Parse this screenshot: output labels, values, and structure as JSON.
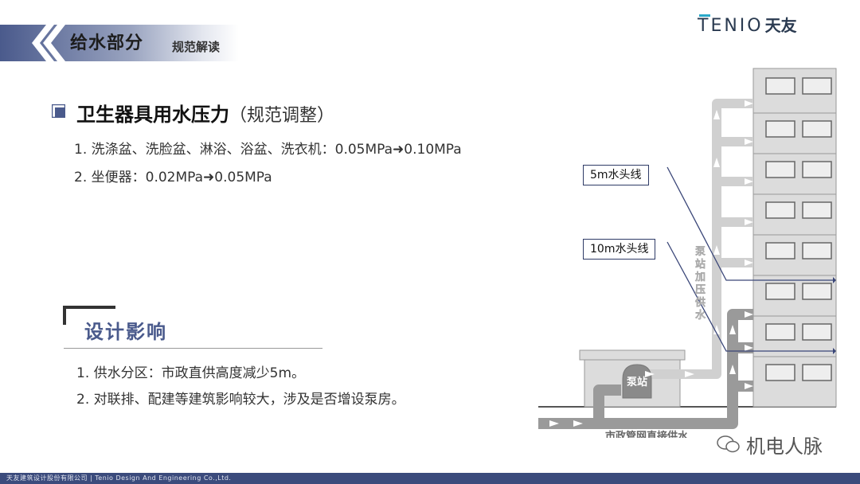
{
  "header": {
    "title": "给水部分",
    "subtitle": "规范解读"
  },
  "logo": {
    "en": "TENIO",
    "cn": "天友"
  },
  "section": {
    "heading": "卫生器具用水压力",
    "heading_note": "（规范调整）",
    "line1": "1. 洗涤盆、洗脸盆、淋浴、浴盆、洗衣机：0.05MPa➜0.10MPa",
    "line2": "2. 坐便器：0.02MPa➜0.05MPa"
  },
  "impact": {
    "title": "设计影响",
    "items": [
      "1.  供水分区：市政直供高度减少5m。",
      "2.  对联排、配建等建筑影响较大，涉及是否增设泵房。"
    ]
  },
  "diagram": {
    "label_5m": "5m水头线",
    "label_10m": "10m水头线",
    "pump_station": "泵站",
    "pump_supply_vertical": "泵站加压供水",
    "municipal_supply": "市政管网直接供水"
  },
  "watermark": "机电人脉",
  "footer": "天友建筑设计股份有限公司   |   Tenio Design And Engineering Co.,Ltd.",
  "colors": {
    "accent": "#4a5a8c",
    "footer": "#3b4b7c",
    "pipe": "#c8c8c8"
  }
}
